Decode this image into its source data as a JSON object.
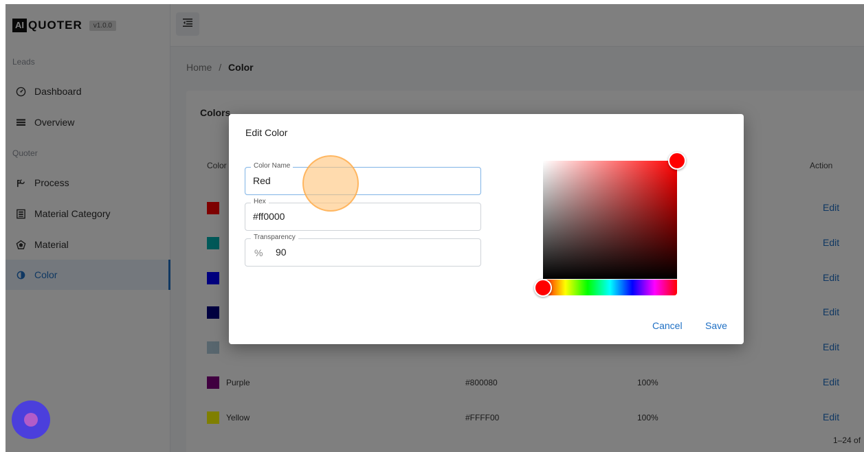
{
  "brand": {
    "logo_mark": "AI",
    "name": "QUOTER",
    "version": "v1.0.0"
  },
  "sidebar": {
    "sections": [
      "Leads",
      "Quoter"
    ],
    "items": [
      {
        "label": "Dashboard",
        "icon": "gauge-icon"
      },
      {
        "label": "Overview",
        "icon": "list-icon"
      },
      {
        "label": "Process",
        "icon": "tool-icon"
      },
      {
        "label": "Material Category",
        "icon": "category-icon"
      },
      {
        "label": "Material",
        "icon": "material-icon"
      },
      {
        "label": "Color",
        "icon": "color-drop-icon",
        "active": true
      }
    ]
  },
  "breadcrumb": {
    "home": "Home",
    "sep": "/",
    "current": "Color"
  },
  "card": {
    "title": "Colors",
    "columns": [
      "Color",
      "Action"
    ],
    "rows": [
      {
        "name": "",
        "hex": "",
        "transparency": "",
        "swatch": "#ff0000",
        "action": "Edit"
      },
      {
        "name": "",
        "hex": "",
        "transparency": "",
        "swatch": "#00b3b3",
        "action": "Edit"
      },
      {
        "name": "",
        "hex": "",
        "transparency": "",
        "swatch": "#0000ff",
        "action": "Edit"
      },
      {
        "name": "",
        "hex": "",
        "transparency": "",
        "swatch": "#000080",
        "action": "Edit"
      },
      {
        "name": "",
        "hex": "",
        "transparency": "",
        "swatch": "#b0ccdc",
        "action": "Edit"
      },
      {
        "name": "Purple",
        "hex": "#800080",
        "transparency": "100%",
        "swatch": "#800080",
        "action": "Edit"
      },
      {
        "name": "Yellow",
        "hex": "#FFFF00",
        "transparency": "100%",
        "swatch": "#ffff00",
        "action": "Edit"
      }
    ],
    "pagination": "1–24 of"
  },
  "dialog": {
    "title": "Edit Color",
    "color_name_label": "Color Name",
    "color_name_value": "Red",
    "hex_label": "Hex",
    "hex_value": "#ff0000",
    "transparency_label": "Transparency",
    "transparency_prefix": "%",
    "transparency_value": "90",
    "cancel_label": "Cancel",
    "save_label": "Save",
    "selected_color": "#ff0000"
  },
  "colors": {
    "accent": "#1e6fc4",
    "fab": "#4b3fdc"
  }
}
